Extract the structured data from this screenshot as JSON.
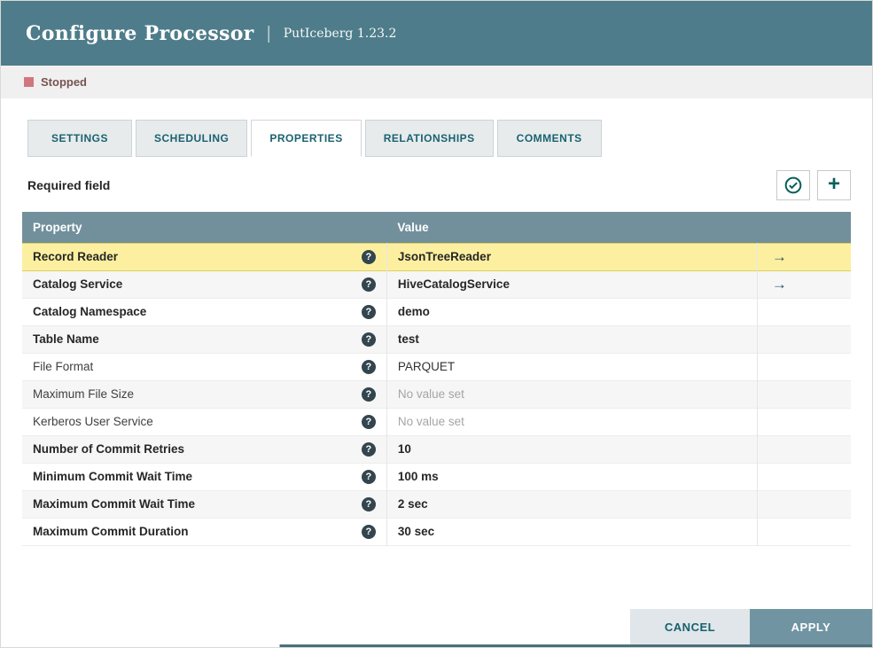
{
  "header": {
    "title": "Configure Processor",
    "separator": "|",
    "subtitle": "PutIceberg 1.23.2"
  },
  "status": {
    "label": "Stopped",
    "icon": "stopped-square-icon"
  },
  "tabs": [
    {
      "id": "settings",
      "label": "SETTINGS",
      "active": false
    },
    {
      "id": "scheduling",
      "label": "SCHEDULING",
      "active": false
    },
    {
      "id": "properties",
      "label": "PROPERTIES",
      "active": true
    },
    {
      "id": "relationships",
      "label": "RELATIONSHIPS",
      "active": false
    },
    {
      "id": "comments",
      "label": "COMMENTS",
      "active": false
    }
  ],
  "toolbar": {
    "required_field_label": "Required field",
    "verify_icon": "checkmark-circle-icon",
    "add_icon": "plus-icon",
    "add_glyph": "+"
  },
  "table": {
    "columns": [
      "Property",
      "Value"
    ],
    "help_icon": "question-circle-icon",
    "help_glyph": "?",
    "link_icon": "go-to-service-arrow-icon",
    "link_glyph": "→",
    "rows": [
      {
        "property": "Record Reader",
        "value": "JsonTreeReader",
        "required": true,
        "selected": true,
        "has_link": true,
        "no_value": false
      },
      {
        "property": "Catalog Service",
        "value": "HiveCatalogService",
        "required": true,
        "selected": false,
        "has_link": true,
        "no_value": false
      },
      {
        "property": "Catalog Namespace",
        "value": "demo",
        "required": true,
        "selected": false,
        "has_link": false,
        "no_value": false
      },
      {
        "property": "Table Name",
        "value": "test",
        "required": true,
        "selected": false,
        "has_link": false,
        "no_value": false
      },
      {
        "property": "File Format",
        "value": "PARQUET",
        "required": false,
        "selected": false,
        "has_link": false,
        "no_value": false
      },
      {
        "property": "Maximum File Size",
        "value": "No value set",
        "required": false,
        "selected": false,
        "has_link": false,
        "no_value": true
      },
      {
        "property": "Kerberos User Service",
        "value": "No value set",
        "required": false,
        "selected": false,
        "has_link": false,
        "no_value": true
      },
      {
        "property": "Number of Commit Retries",
        "value": "10",
        "required": true,
        "selected": false,
        "has_link": false,
        "no_value": false
      },
      {
        "property": "Minimum Commit Wait Time",
        "value": "100 ms",
        "required": true,
        "selected": false,
        "has_link": false,
        "no_value": false
      },
      {
        "property": "Maximum Commit Wait Time",
        "value": "2 sec",
        "required": true,
        "selected": false,
        "has_link": false,
        "no_value": false
      },
      {
        "property": "Maximum Commit Duration",
        "value": "30 sec",
        "required": true,
        "selected": false,
        "has_link": false,
        "no_value": false
      }
    ]
  },
  "footer": {
    "cancel_label": "CANCEL",
    "apply_label": "APPLY"
  },
  "colors": {
    "header_bg": "#4e7c8a",
    "table_header_bg": "#72909c",
    "tab_text": "#1a6270",
    "selected_row_bg": "#fcf0a0",
    "selected_row_border": "#ddd05a",
    "apply_bg": "#7094a1",
    "cancel_bg": "#e0e6e9",
    "stopped_red": "#d0777d",
    "accent_teal": "#07605c"
  }
}
